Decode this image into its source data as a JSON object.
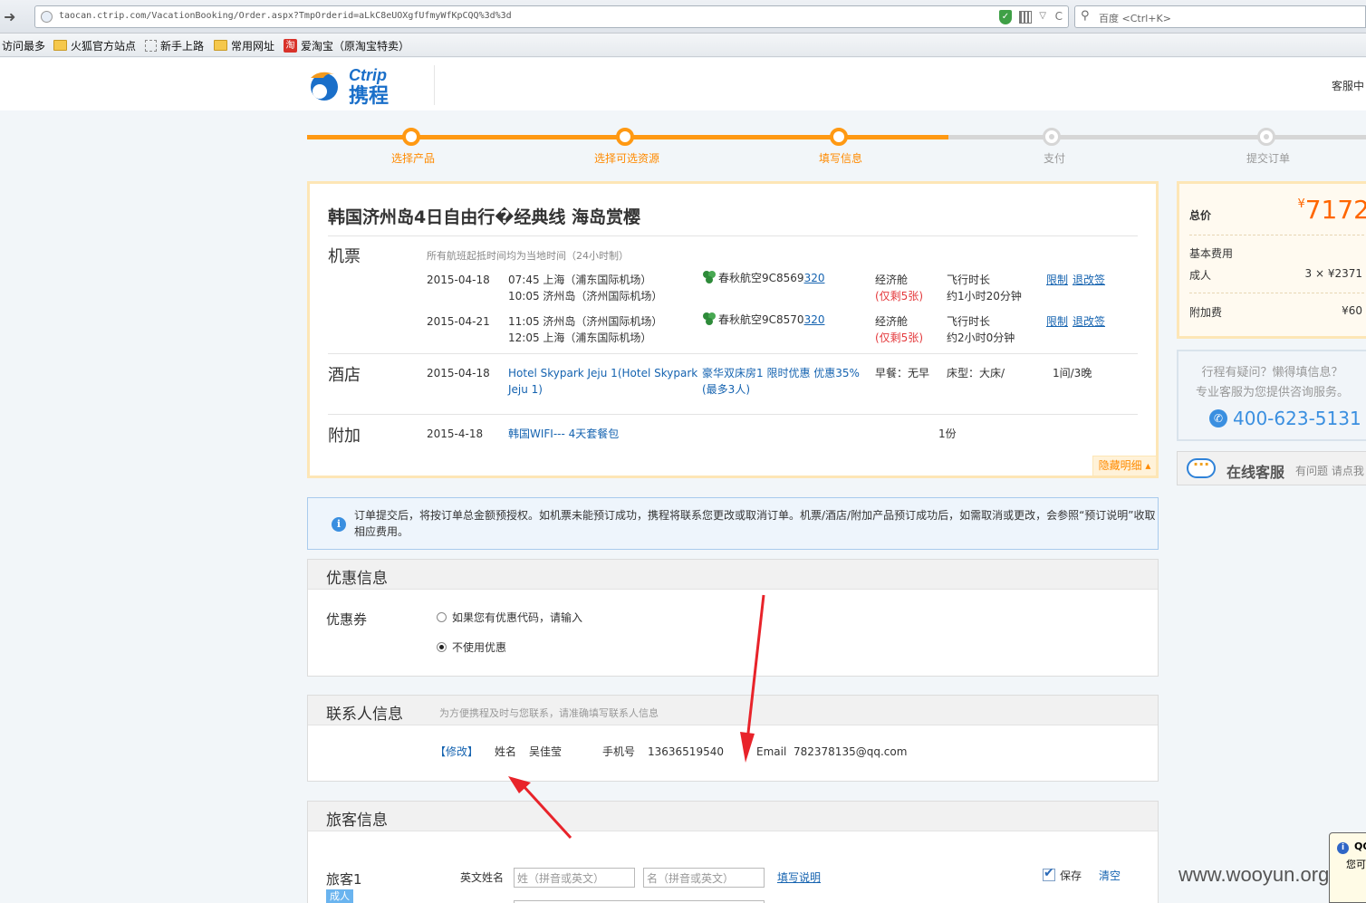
{
  "browser": {
    "url": "taocan.ctrip.com/VacationBooking/Order.aspx?TmpOrderid=aLkC8eUOXgfUfmyWfKpCQQ%3d%3d",
    "search_placeholder": "百度 <Ctrl+K>",
    "bookmarks": [
      "访问最多",
      "火狐官方站点",
      "新手上路",
      "常用网址",
      "爱淘宝（原淘宝特卖）"
    ]
  },
  "header": {
    "logo_en": "Ctrip",
    "logo_cn": "携程",
    "service_link": "客服中"
  },
  "steps": [
    {
      "label": "选择产品",
      "state": "done"
    },
    {
      "label": "选择可选资源",
      "state": "done"
    },
    {
      "label": "填写信息",
      "state": "done"
    },
    {
      "label": "支付",
      "state": "todo"
    },
    {
      "label": "提交订单",
      "state": "todo"
    }
  ],
  "order": {
    "title": "韩国济州岛4日自由行�经典线 海岛赏樱",
    "flight_label": "机票",
    "flight_note": "所有航班起抵时间均为当地时间（24小时制）",
    "flights": [
      {
        "date": "2015-04-18",
        "dep": "07:45 上海（浦东国际机场）",
        "arr": "10:05 济州岛（济州国际机场）",
        "airline": "春秋航空9C8569",
        "code": "320",
        "cabin": "经济舱",
        "seats": "(仅剩5张)",
        "duration_label": "飞行时长",
        "duration": "约1小时20分钟",
        "rule": "限制",
        "change": "退改签"
      },
      {
        "date": "2015-04-21",
        "dep": "11:05 济州岛（济州国际机场）",
        "arr": "12:05 上海（浦东国际机场）",
        "airline": "春秋航空9C8570",
        "code": "320",
        "cabin": "经济舱",
        "seats": "(仅剩5张)",
        "duration_label": "飞行时长",
        "duration": "约2小时0分钟",
        "rule": "限制",
        "change": "退改签"
      }
    ],
    "hotel_label": "酒店",
    "hotel": {
      "date": "2015-04-18",
      "name_line1": "Hotel Skypark Jeju 1(Hotel Skypark",
      "name_line2": "Jeju 1)",
      "room_line1": "豪华双床房1 限时优惠 优惠35%",
      "room_line2": "(最多3人)",
      "breakfast": "早餐：无早",
      "bed": "床型：大床/",
      "qty": "1间/3晚"
    },
    "extra_label": "附加",
    "extra": {
      "date": "2015-4-18",
      "name": "韩国WIFI--- 4天套餐包",
      "qty": "1份"
    },
    "hide_detail": "隐藏明细"
  },
  "price": {
    "total_label": "总价",
    "currency": "¥",
    "total": "7172",
    "base_label": "基本费用",
    "adult_label": "成人",
    "adult_value": "3 × ¥2371",
    "extra_label": "附加费",
    "extra_value": "¥60"
  },
  "help": {
    "line1": "行程有疑问？懒得填信息？",
    "line2": "专业客服为您提供咨询服务。",
    "phone": "400-623-5131"
  },
  "online": {
    "title": "在线客服",
    "sub": "有问题 请点我"
  },
  "notice": "订单提交后，将按订单总金额预授权。如机票未能预订成功，携程将联系您更改或取消订单。机票/酒店/附加产品预订成功后，如需取消或更改，会参照“预订说明”收取相应费用。",
  "discount": {
    "title": "优惠信息",
    "field": "优惠券",
    "option1": "如果您有优惠代码，请输入",
    "option2": "不使用优惠"
  },
  "contact": {
    "title": "联系人信息",
    "subtitle": "为方便携程及时与您联系，请准确填写联系人信息",
    "edit": "【修改】",
    "name_label": "姓名",
    "name": "吴佳莹",
    "phone_label": "手机号",
    "phone": "13636519540",
    "email_label": "Email",
    "email": "782378135@qq.com"
  },
  "traveler": {
    "title": "旅客信息",
    "label": "旅客1",
    "tag": "成人",
    "en_name_label": "英文姓名",
    "surname_placeholder": "姓（拼音或英文）",
    "given_placeholder": "名（拼音或英文）",
    "help_link": "填写说明",
    "save_label": "保存",
    "clear_label": "清空"
  },
  "watermark": "www.wooyun.org",
  "qq_popup": {
    "title": "QQ",
    "text": "您可"
  },
  "colors": {
    "accent": "#ff9913",
    "link": "#1563b0",
    "price": "#ff6600",
    "annotation": "#e8232a"
  }
}
